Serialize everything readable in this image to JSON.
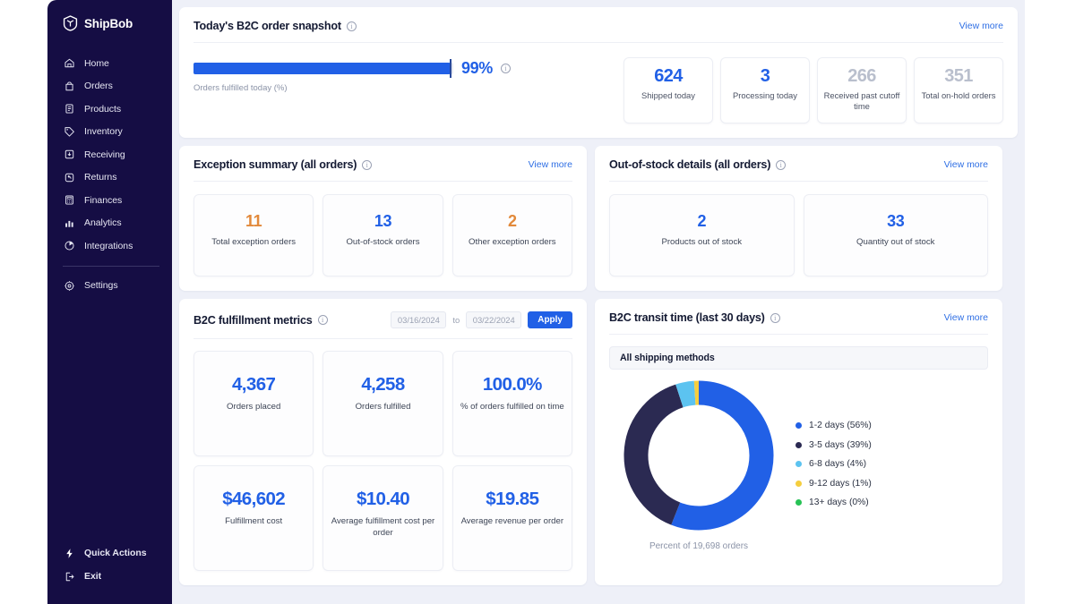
{
  "sidebar": {
    "brand": "ShipBob",
    "brand_logo_icon": "shipbob-shield-icon",
    "items": [
      {
        "label": "Home",
        "icon": "home-icon"
      },
      {
        "label": "Orders",
        "icon": "bag-icon"
      },
      {
        "label": "Products",
        "icon": "document-list-icon"
      },
      {
        "label": "Inventory",
        "icon": "tag-icon"
      },
      {
        "label": "Receiving",
        "icon": "inbox-down-icon"
      },
      {
        "label": "Returns",
        "icon": "return-arrow-icon"
      },
      {
        "label": "Finances",
        "icon": "calculator-icon"
      },
      {
        "label": "Analytics",
        "icon": "bar-chart-icon"
      },
      {
        "label": "Integrations",
        "icon": "pie-slice-icon"
      }
    ],
    "settings": {
      "label": "Settings",
      "icon": "gear-icon"
    },
    "bottom": [
      {
        "label": "Quick Actions",
        "icon": "lightning-bolt-icon"
      },
      {
        "label": "Exit",
        "icon": "logout-icon"
      }
    ]
  },
  "snapshot": {
    "title": "Today's B2C order snapshot",
    "info_icon": "info-icon",
    "view_more": "View more",
    "progress": {
      "percent_label": "99%",
      "percent_value": 99,
      "caption": "Orders fulfilled today (%)",
      "info_icon": "info-icon"
    },
    "stats": [
      {
        "value": "624",
        "label": "Shipped today",
        "color": "blue"
      },
      {
        "value": "3",
        "label": "Processing today",
        "color": "blue"
      },
      {
        "value": "266",
        "label": "Received past cutoff time",
        "color": "grey"
      },
      {
        "value": "351",
        "label": "Total on-hold orders",
        "color": "grey"
      }
    ]
  },
  "exception_summary": {
    "title": "Exception summary (all orders)",
    "info_icon": "info-icon",
    "view_more": "View more",
    "cards": [
      {
        "value": "11",
        "label": "Total exception orders",
        "color": "orange"
      },
      {
        "value": "13",
        "label": "Out-of-stock orders",
        "color": "blue"
      },
      {
        "value": "2",
        "label": "Other exception orders",
        "color": "orange"
      }
    ]
  },
  "out_of_stock": {
    "title": "Out-of-stock details (all orders)",
    "info_icon": "info-icon",
    "view_more": "View more",
    "cards": [
      {
        "value": "2",
        "label": "Products out of stock",
        "color": "blue"
      },
      {
        "value": "33",
        "label": "Quantity out of stock",
        "color": "blue"
      }
    ]
  },
  "fulfillment_metrics": {
    "title": "B2C fulfillment metrics",
    "info_icon": "info-icon",
    "date_from": "03/16/2024",
    "date_to": "03/22/2024",
    "to_label": "to",
    "apply_label": "Apply",
    "cards": [
      {
        "value": "4,367",
        "label": "Orders placed"
      },
      {
        "value": "4,258",
        "label": "Orders fulfilled"
      },
      {
        "value": "100.0%",
        "label": "% of orders fulfilled on time"
      },
      {
        "value": "$46,602",
        "label": "Fulfillment cost"
      },
      {
        "value": "$10.40",
        "label": "Average fulfillment cost per order"
      },
      {
        "value": "$19.85",
        "label": "Average revenue per order"
      }
    ]
  },
  "transit_time": {
    "title": "B2C transit time (last 30 days)",
    "info_icon": "info-icon",
    "view_more": "View more",
    "filter_value": "All shipping methods",
    "chevron_icon": "chevron-down-icon",
    "caption": "Percent of 19,698 orders"
  },
  "chart_data": {
    "type": "pie",
    "title": "B2C transit time (last 30 days)",
    "subtitle": "Percent of 19,698 orders",
    "total_orders": 19698,
    "donut": true,
    "legend_position": "right",
    "categories": [
      "1-2 days",
      "3-5 days",
      "6-8 days",
      "9-12 days",
      "13+ days"
    ],
    "values": [
      56,
      39,
      4,
      1,
      0
    ],
    "unit": "%",
    "colors": [
      "#2160e6",
      "#2b2a52",
      "#5cc3f0",
      "#f5ce3e",
      "#27c255"
    ],
    "legend": [
      "1-2 days (56%)",
      "3-5 days (39%)",
      "6-8 days (4%)",
      "9-12 days (1%)",
      "13+ days (0%)"
    ]
  },
  "theme": {
    "accent_blue": "#2160e6",
    "sidebar_bg": "#150d44",
    "page_bg": "#eef0f8",
    "orange": "#e2893a",
    "grey_number": "#b9bfcd"
  }
}
